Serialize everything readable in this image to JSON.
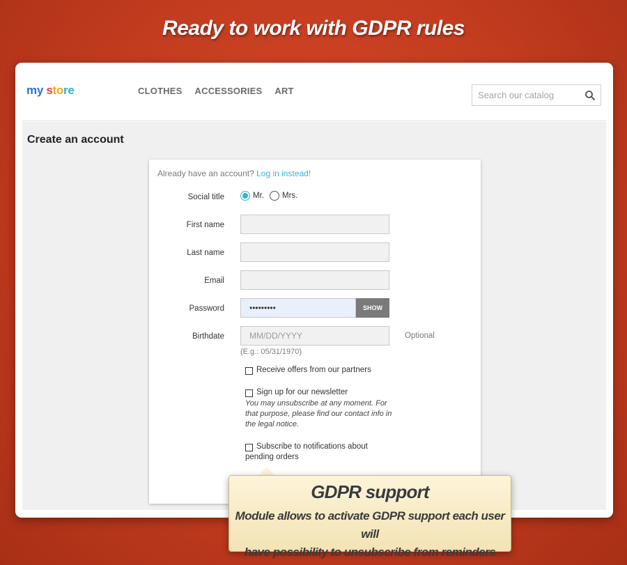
{
  "banner": {
    "title": "Ready to work with GDPR rules"
  },
  "header": {
    "logo": {
      "part1": "my ",
      "part2": "s",
      "part3": "to",
      "part4": "re"
    },
    "nav": [
      "CLOTHES",
      "ACCESSORIES",
      "ART"
    ],
    "search": {
      "placeholder": "Search our catalog",
      "icon": "search-icon"
    }
  },
  "page": {
    "title": "Create an account",
    "already_text": "Already have an account? ",
    "login_link": "Log in instead!"
  },
  "form": {
    "social_title_label": "Social title",
    "options": [
      {
        "label": "Mr.",
        "selected": true
      },
      {
        "label": "Mrs.",
        "selected": false
      }
    ],
    "first_name_label": "First name",
    "last_name_label": "Last name",
    "email_label": "Email",
    "password_label": "Password",
    "password_value": "•••••••••",
    "show_label": "SHOW",
    "birthdate_label": "Birthdate",
    "birthdate_placeholder": "MM/DD/YYYY",
    "birthdate_hint": "(E.g.: 05/31/1970)",
    "optional": "Optional",
    "checkboxes": {
      "partners": "Receive offers from our partners",
      "newsletter": "Sign up for our newsletter",
      "newsletter_note": "You may unsubscribe at any moment. For that purpose, please find our contact info in the legal notice.",
      "notifications": "Subscribe to notifications about pending orders"
    }
  },
  "callout": {
    "title": "GDPR support",
    "line1": "Module allows to activate GDPR support each user will",
    "line2": "have possibility to unsubscribe from reminders"
  },
  "colors": {
    "background": "#c23c1f",
    "accent": "#2fb5d2",
    "callout_bg": "#fdf4d9",
    "show_button": "#7a7a7a"
  }
}
